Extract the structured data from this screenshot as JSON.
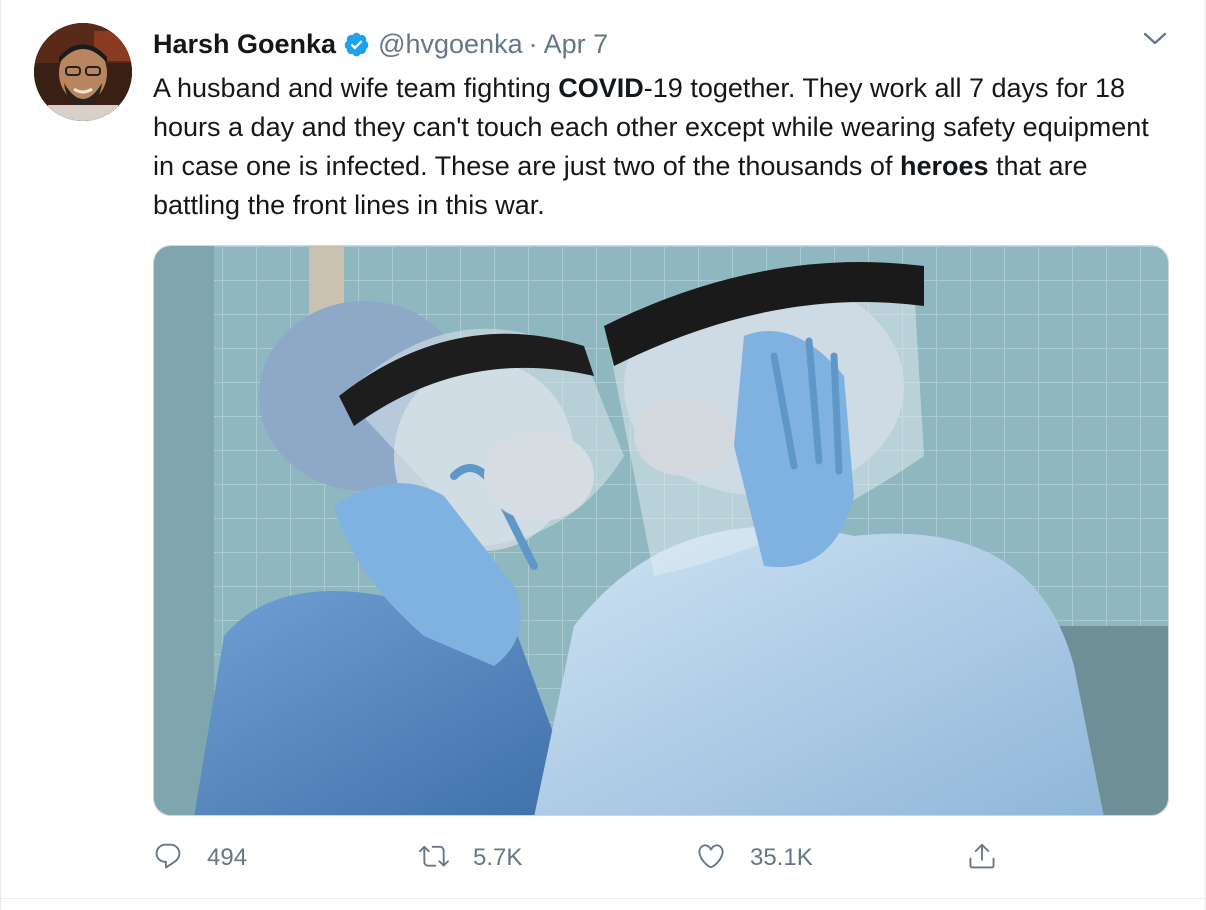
{
  "author": {
    "name": "Harsh Goenka",
    "handle": "@hvgoenka",
    "separator": "·",
    "date": "Apr 7"
  },
  "text": {
    "seg1": "A husband and wife team fighting ",
    "bold1": "COVID",
    "seg2": "-19 together. They work all 7 days for 18 hours a day and they can't touch each other except while wearing safety equipment in case one is infected. These are just two of the thousands of ",
    "bold2": "heroes",
    "seg3": " that are battling the front lines in this war."
  },
  "actions": {
    "reply_count": "494",
    "retweet_count": "5.7K",
    "like_count": "35.1K"
  },
  "colors": {
    "verified": "#1da1f2",
    "secondary_text": "#657786",
    "primary_text": "#14171a"
  },
  "icons": {
    "verified": "verified-badge-icon",
    "menu": "chevron-down-icon",
    "reply": "reply-icon",
    "retweet": "retweet-icon",
    "like": "heart-icon",
    "share": "share-icon"
  }
}
